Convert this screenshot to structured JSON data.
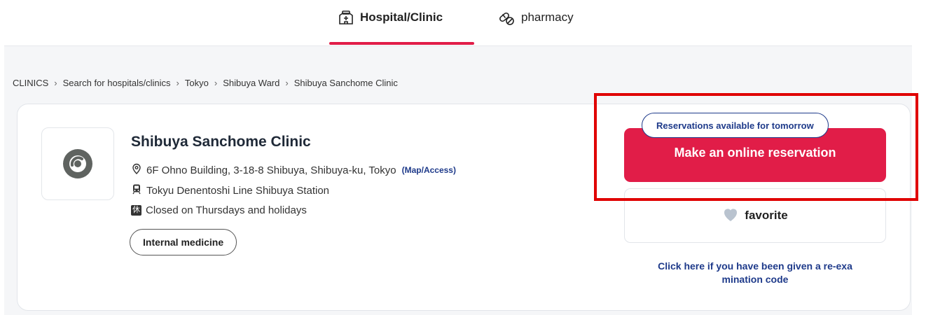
{
  "nav": {
    "tabs": [
      {
        "label": "Hospital/Clinic",
        "icon": "hospital-icon",
        "active": true
      },
      {
        "label": "pharmacy",
        "icon": "pill-icon",
        "active": false
      }
    ],
    "accent_color": "#e11d48"
  },
  "breadcrumb": [
    "CLINICS",
    "Search for hospitals/clinics",
    "Tokyo",
    "Shibuya Ward",
    "Shibuya Sanchome Clinic"
  ],
  "clinic": {
    "name": "Shibuya Sanchome Clinic",
    "address": "6F Ohno Building, 3-18-8 Shibuya, Shibuya-ku, Tokyo",
    "map_link": "(Map/Access)",
    "station": "Tokyu Denentoshi Line Shibuya Station",
    "closed_badge": "休",
    "closed": "Closed on Thursdays and holidays",
    "tags": [
      "Internal medicine"
    ]
  },
  "actions": {
    "availability": "Reservations available for tomorrow",
    "reserve_label": "Make an online reservation",
    "favorite_label": "favorite",
    "reexam_line1": "Click here if you have been given a re-exa",
    "reexam_line2": "mination code"
  },
  "colors": {
    "reserve_button": "#e11d48",
    "link_blue": "#1e3a8a",
    "highlight": "#e00000"
  }
}
